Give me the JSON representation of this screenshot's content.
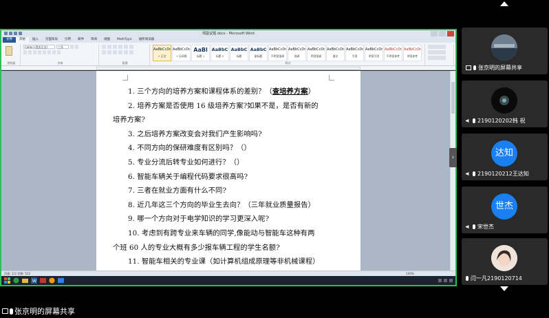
{
  "word": {
    "title": "师副议题.docx - Microsoft Word",
    "tabs": [
      "文件",
      "开始",
      "插入",
      "页面布局",
      "引用",
      "邮件",
      "审阅",
      "视图",
      "MathType",
      "福昕阅读器"
    ],
    "font_name": "Calibri (西文正文)",
    "font_size": "三号",
    "group_labels": {
      "clipboard": "剪贴板",
      "font": "字体",
      "paragraph": "段落",
      "styles": "样式"
    },
    "styles": [
      {
        "sample": "AaBbCcDd",
        "name": "+ 正文"
      },
      {
        "sample": "AaBbCcDd",
        "name": "+ 无间隔"
      },
      {
        "sample": "AaBl",
        "name": "标题 1"
      },
      {
        "sample": "AaBbC",
        "name": "标题 2"
      },
      {
        "sample": "AaBbC",
        "name": "标题"
      },
      {
        "sample": "AaBbC",
        "name": "副标题"
      },
      {
        "sample": "AaBbCcDd",
        "name": "不明显强调"
      },
      {
        "sample": "AaBbCcDd",
        "name": "强调"
      },
      {
        "sample": "AaBbCcDd",
        "name": "明显强调"
      },
      {
        "sample": "AaBbCcDd",
        "name": "要点"
      },
      {
        "sample": "AaBbCcDd",
        "name": "引用"
      },
      {
        "sample": "AaBbCcDd",
        "name": "明显引用"
      },
      {
        "sample": "AaBbCcDd",
        "name": "不明显参考"
      },
      {
        "sample": "AaBbCcDd",
        "name": "明显参考"
      }
    ],
    "document": {
      "l1_pre": "1.  三个方向的培养方案和课程体系的差别？（",
      "l1_bold": "查培养方案",
      "l1_post": "）",
      "l2": "2.  培养方案是否使用 16 级培养方案?如果不是，是否有新的",
      "l2b": "培养方案?",
      "l3": "3.  之后培养方案改变会对我们产生影响吗?",
      "l4": "4.  不同方向的保研难度有区别吗？（）",
      "l5": "5.  专业分流后转专业如何进行？（）",
      "l6": "6.  智能车辆关于编程代码要求很高吗?",
      "l7": "7.  三者在就业方面有什么不同?",
      "l8": "8.  近几年这三个方向的毕业生去向？（三年就业质量报告）",
      "l9": "9.  哪一个方向对于电学知识的学习更深入呢?",
      "l10": "10.  考虑到有跨专业来车辆的同学,像能动与智能车这种有两",
      "l10b": "个班 60 人的专业大概有多少报车辆工程的学生名额?",
      "l11": "11.  智能车相关的专业课（如计算机组成原理等非机械课程）"
    },
    "status_left": "页面: 1/2    字数: 522",
    "status_zoom": "140%"
  },
  "share_label": "张京明的屏幕共享",
  "participants": [
    {
      "name": "张京明的屏幕共享",
      "kind": "screen"
    },
    {
      "name": "2190120202韩 祝",
      "kind": "camera"
    },
    {
      "name": "2190120212王达知",
      "kind": "initials",
      "initials": "达知",
      "color": "#1a7ff0"
    },
    {
      "name": "宋世杰",
      "kind": "initials",
      "initials": "世杰",
      "color": "#1a7ff0"
    },
    {
      "name": "闫一凡2190120714",
      "kind": "photo"
    }
  ],
  "colors": {
    "accent_green": "#2ebd58",
    "word_blue": "#2b5797"
  }
}
